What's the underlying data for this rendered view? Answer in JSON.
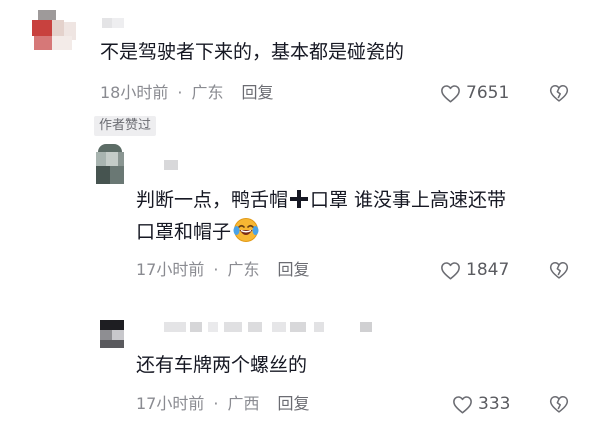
{
  "comments": [
    {
      "text": "不是驾驶者下来的，基本都是碰瓷的",
      "time": "18小时前",
      "location": "广东",
      "reply_label": "回复",
      "like_count": "7651",
      "badge": "作者赞过"
    },
    {
      "text_part1": "判断一点，鸭舌帽",
      "text_part2": "口罩 谁没事上高速还带",
      "text_line2": "口罩和帽子",
      "time": "17小时前",
      "location": "广东",
      "reply_label": "回复",
      "like_count": "1847"
    },
    {
      "text": "还有车牌两个螺丝的",
      "time": "17小时前",
      "location": "广西",
      "reply_label": "回复",
      "like_count": "333"
    }
  ],
  "separator": "·",
  "icons": {
    "like": "heart-outline-icon",
    "dislike": "broken-heart-icon",
    "plus": "heavy-plus-icon",
    "emoji": "laughing-crying-emoji"
  },
  "colors": {
    "text": "#161823",
    "meta": "#8a8b91",
    "badge_bg": "#eeeef0"
  }
}
